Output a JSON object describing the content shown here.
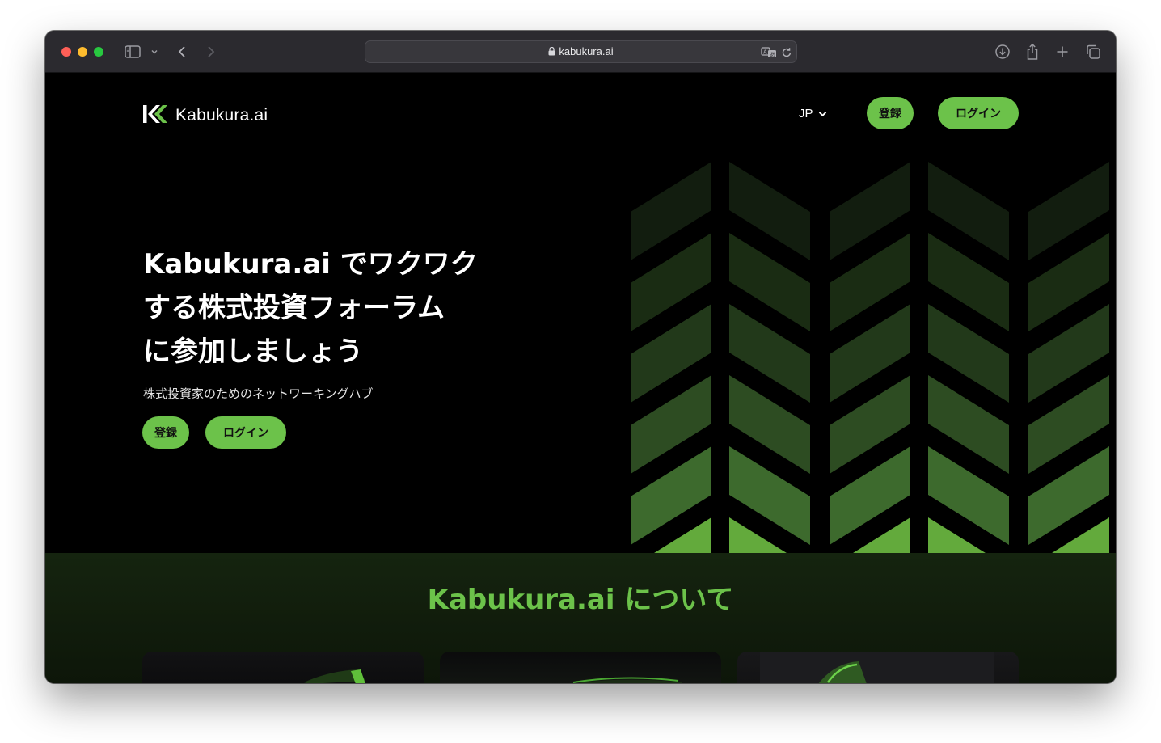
{
  "browser": {
    "url": "kabukura.ai"
  },
  "nav": {
    "logo_text": "Kabukura.ai",
    "language": "JP",
    "register_label": "登録",
    "login_label": "ログイン"
  },
  "hero": {
    "title_lines": [
      "Kabukura.ai でワクワク",
      "する株式投資フォーラム",
      "に参加しましょう"
    ],
    "subtitle": "株式投資家のためのネットワーキングハブ",
    "register_label": "登録",
    "login_label": "ログイン"
  },
  "about": {
    "title": "Kabukura.ai について"
  },
  "colors": {
    "accent": "#6cc24a",
    "background": "#000000",
    "about_background": "#15240f"
  },
  "icons": [
    "sidebar-icon",
    "chevron-down-icon",
    "back-icon",
    "forward-icon",
    "lock-icon",
    "translate-icon",
    "reload-icon",
    "download-icon",
    "share-icon",
    "new-tab-icon",
    "tabs-overview-icon",
    "logo-mark-icon"
  ]
}
